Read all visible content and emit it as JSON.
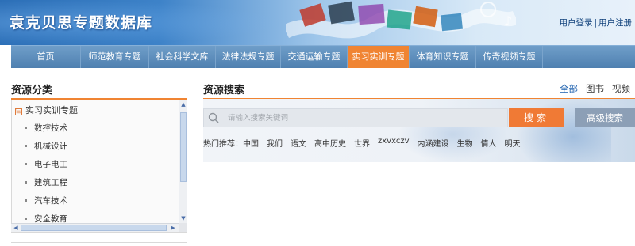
{
  "header": {
    "logo": "袁克贝思专题数据库",
    "login": "用户登录",
    "separator": "|",
    "register": "用户注册"
  },
  "nav": {
    "items": [
      {
        "label": "首页"
      },
      {
        "label": "师范教育专题"
      },
      {
        "label": "社会科学文库"
      },
      {
        "label": "法律法规专题"
      },
      {
        "label": "交通运输专题"
      },
      {
        "label": "实习实训专题",
        "active": true
      },
      {
        "label": "体育知识专题"
      },
      {
        "label": "传奇视频专题"
      }
    ],
    "active_color": "#f08432"
  },
  "sidebar": {
    "title": "资源分类",
    "root": {
      "toggle": "⊟",
      "label": "实习实训专题"
    },
    "items": [
      {
        "label": "数控技术"
      },
      {
        "label": "机械设计"
      },
      {
        "label": "电子电工"
      },
      {
        "label": "建筑工程"
      },
      {
        "label": "汽车技术"
      },
      {
        "label": "安全教育"
      }
    ]
  },
  "main": {
    "title": "资源搜索",
    "tabs": [
      {
        "label": "全部",
        "active": true
      },
      {
        "label": "图书"
      },
      {
        "label": "视频"
      }
    ],
    "search": {
      "placeholder": "请输入搜索关键词",
      "button": "搜索",
      "advanced": "高级搜索"
    },
    "hot": {
      "label": "热门推荐：",
      "keywords": [
        "中国",
        "我们",
        "语文",
        "高中历史",
        "世界",
        "zxvxczv",
        "内涵建设",
        "生物",
        "情人",
        "明天"
      ]
    }
  },
  "colors": {
    "accent": "#f08432",
    "nav_blue": "#5a8bbd",
    "advanced_button": "#8c9fb6"
  }
}
